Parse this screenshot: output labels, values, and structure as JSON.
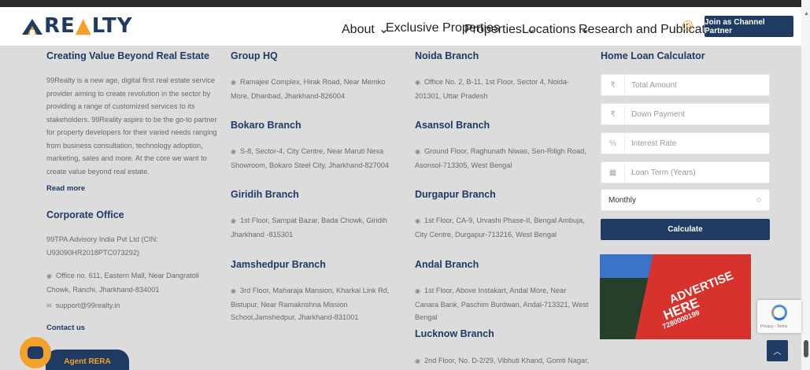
{
  "header": {
    "logo_text_a": "RE",
    "logo_text_b": "LTY",
    "nav": [
      {
        "label": "About",
        "chevron": true
      },
      {
        "label": "Exclusive Properties",
        "chevron": false
      },
      {
        "label": "Properties",
        "chevron": true
      },
      {
        "label": "Locations",
        "chevron": true
      },
      {
        "label": "Research and Publications",
        "chevron": true
      }
    ],
    "cta_label": "Join as Channel Partner"
  },
  "about": {
    "heading": "Creating Value Beyond Real Estate",
    "body": "99Realty is a new age, digital first real estate service provider aiming to create revolution in the sector by providing a range of customized services to its stakeholders. 99Reality aspire to be the go-to partner for property developers for their varied needs ranging from business consultation, technology adoption, marketing, sales and more. At the core we want to create value beyond real estate.",
    "read_more": "Read more"
  },
  "corporate": {
    "heading": "Corporate Office",
    "company": "99TPA Advisory India Pvt Ltd (CIN: U93090HR2018PTC073292)",
    "address": "Office no. 611, Eastern Mall, Near Dangratoli Chowk, Ranchi, Jharkhand-834001",
    "email": "support@99realty.in",
    "contact": "Contact us"
  },
  "branches": {
    "group_hq": {
      "heading": "Group HQ",
      "address": "Ramajee Complex, Hirak Road, Near Memko More, Dhanbad, Jharkhand-826004"
    },
    "bokaro": {
      "heading": "Bokaro Branch",
      "address": "S-8, Sector-4, City Centre, Near Maruti Nexa Showroom, Bokaro Steel City, Jharkhand-827004"
    },
    "giridih": {
      "heading": "Giridih Branch",
      "address": "1st Floor, Sampat Bazar, Bada Chowk, Giridih Jharkhand -815301"
    },
    "jamshedpur": {
      "heading": "Jamshedpur Branch",
      "address": "3rd Floor, Maharaja Mansion, Kharkai Link Rd, Bistupur, Near Ramakrishna Mission School,Jamshedpur, Jharkhand-831001"
    },
    "noida": {
      "heading": "Noida Branch",
      "address": "Office No. 2, B-11, 1st Floor, Sector 4, Noida-201301, Uttar Pradesh"
    },
    "asansol": {
      "heading": "Asansol Branch",
      "address": "Ground Floor, Raghunath Niwas, Sen-Riligh Road, Asonsol-713305, West Bengal"
    },
    "durgapur": {
      "heading": "Durgapur Branch",
      "address": "1st Floor, CA-9, Urvashi Phase-II, Bengal Ambuja, City Centre, Durgapur-713216, West Bengal"
    },
    "andal": {
      "heading": "Andal Branch",
      "address": "1st Floor, Above Instakart, Andal More, Near Canara Bank, Paschim Burdwan, Andal-713321, West Bengal"
    },
    "lucknow": {
      "heading": "Lucknow Branch",
      "address": "2nd Floor, No. D-2/29, Vibhuti Khand, Gomti Nagar,"
    }
  },
  "calculator": {
    "heading": "Home Loan Calculator",
    "total_amount": "Total Amount",
    "down_payment": "Down Payment",
    "interest_rate": "Interest Rate",
    "loan_term": "Loan Term (Years)",
    "frequency": "Monthly",
    "calculate_label": "Calculate",
    "currency_symbol": "₹",
    "percent_symbol": "%"
  },
  "ad": {
    "line1": "ADVERTISE",
    "line2": "HERE",
    "phone": "7280000199"
  },
  "recaptcha_terms": "Privacy - Terms",
  "rera_label": "Agent RERA",
  "colors": {
    "brand_navy": "#1f3a63",
    "brand_orange": "#f2a12b"
  }
}
